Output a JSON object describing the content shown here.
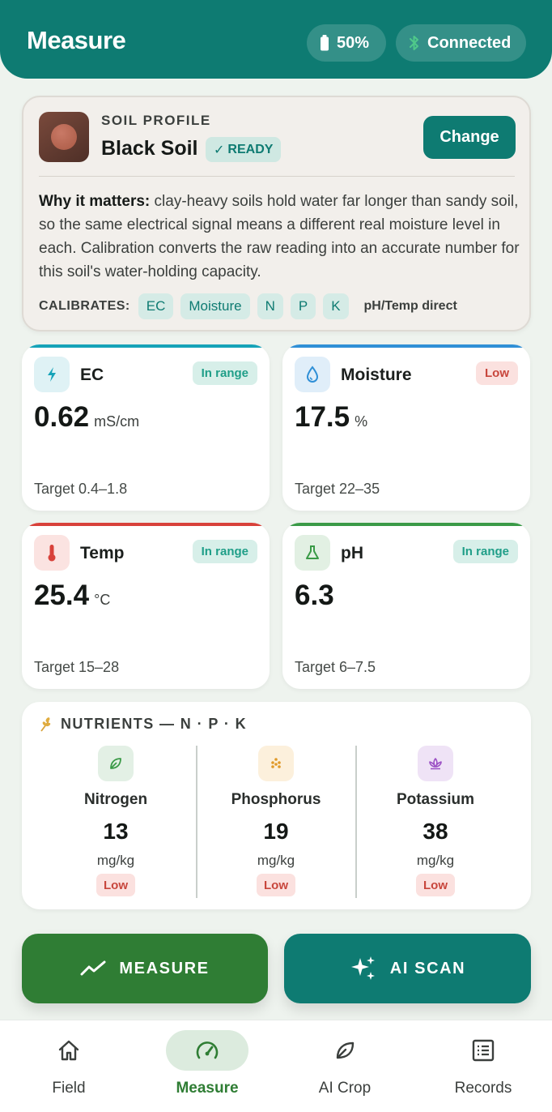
{
  "header": {
    "title": "Measure",
    "battery": "50%",
    "connection": "Connected"
  },
  "profile": {
    "eyebrow": "SOIL PROFILE",
    "soil_name": "Black Soil",
    "ready_badge": "READY",
    "change_label": "Change",
    "why_title": "Why it matters:",
    "why_text": " clay-heavy soils hold water far longer than sandy soil, so the same electrical signal means a different real moisture level in each. Calibration converts the raw reading into an accurate number for this soil's water-holding capacity.",
    "calibrates_label": "CALIBRATES:",
    "calibrates": [
      "EC",
      "Moisture",
      "N",
      "P",
      "K"
    ],
    "direct_note": "pH/Temp direct"
  },
  "metrics": [
    {
      "name": "EC",
      "value": "0.62",
      "unit": "mS/cm",
      "status": "In range",
      "target": "Target 0.4–1.8",
      "accent": "#15a3b8",
      "icon": "bolt-icon"
    },
    {
      "name": "Moisture",
      "value": "17.5",
      "unit": "%",
      "status": "Low",
      "target": "Target 22–35",
      "accent": "#2f8fd6",
      "icon": "droplet-icon"
    },
    {
      "name": "Temp",
      "value": "25.4",
      "unit": "°C",
      "status": "In range",
      "target": "Target 15–28",
      "accent": "#d8413a",
      "icon": "thermometer-icon"
    },
    {
      "name": "pH",
      "value": "6.3",
      "unit": "",
      "status": "In range",
      "target": "Target 6–7.5",
      "accent": "#3a9a47",
      "icon": "flask-icon"
    }
  ],
  "nutrients": {
    "heading": "NUTRIENTS — N · P · K",
    "items": [
      {
        "name": "Nitrogen",
        "value": "13",
        "unit": "mg/kg",
        "status": "Low",
        "icon": "leaf-icon"
      },
      {
        "name": "Phosphorus",
        "value": "19",
        "unit": "mg/kg",
        "status": "Low",
        "icon": "dots-icon"
      },
      {
        "name": "Potassium",
        "value": "38",
        "unit": "mg/kg",
        "status": "Low",
        "icon": "lotus-icon"
      }
    ]
  },
  "actions": {
    "measure": "MEASURE",
    "ai_scan": "AI SCAN"
  },
  "nav": [
    {
      "label": "Field",
      "icon": "home-icon",
      "active": false
    },
    {
      "label": "Measure",
      "icon": "gauge-icon",
      "active": true
    },
    {
      "label": "AI Crop",
      "icon": "leaf-icon",
      "active": false
    },
    {
      "label": "Records",
      "icon": "list-icon",
      "active": false
    }
  ],
  "colors": {
    "primary": "#0e7b72",
    "measure_green": "#2f7d34",
    "low_red": "#c8463c",
    "in_range_teal": "#1f9e88"
  }
}
